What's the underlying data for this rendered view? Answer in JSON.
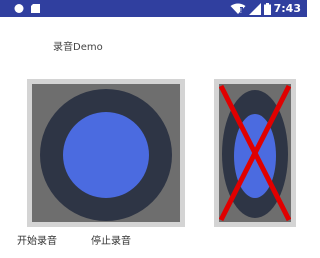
{
  "status_bar": {
    "time": "7:43",
    "left_icons": [
      "circle-icon",
      "sd-card-icon"
    ],
    "right_icons": [
      "wifi-icon",
      "signal-icon",
      "battery-icon"
    ],
    "bar_color": "#303f9f"
  },
  "page": {
    "title": "录音Demo"
  },
  "images": {
    "record_button": {
      "icon": "record-circle-icon",
      "ring_color": "#2e3545",
      "dot_color": "#4b6be0"
    },
    "record_disabled": {
      "icon": "record-disabled-icon",
      "cross_color": "#e00000"
    }
  },
  "buttons": {
    "start_label": "开始录音",
    "stop_label": "停止录音"
  }
}
